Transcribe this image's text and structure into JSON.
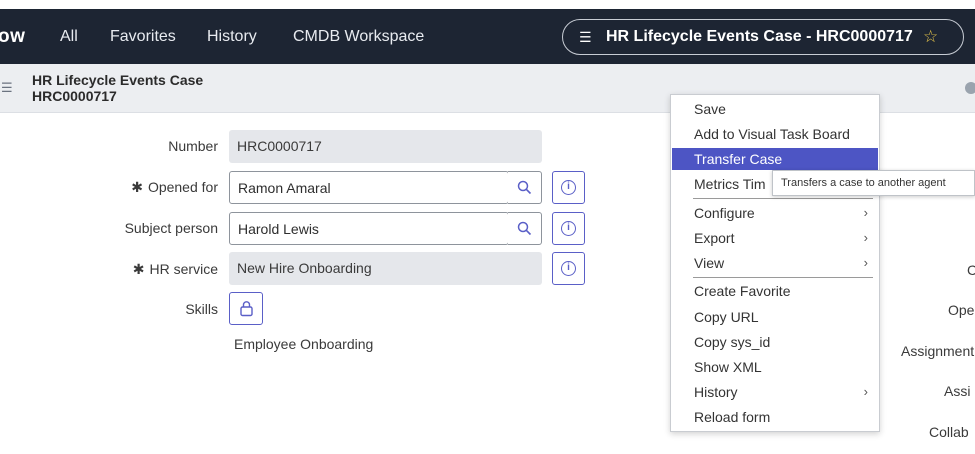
{
  "nav": {
    "logo": "ow",
    "items": [
      "All",
      "Favorites",
      "History",
      "CMDB Workspace"
    ],
    "record_title": "HR Lifecycle Events Case - HRC0000717"
  },
  "header": {
    "title_line1": "HR Lifecycle Events Case",
    "title_line2": "HRC0000717"
  },
  "form": {
    "number_label": "Number",
    "number_value": "HRC0000717",
    "opened_for_label": "Opened for",
    "opened_for_value": "Ramon Amaral",
    "subject_person_label": "Subject person",
    "subject_person_value": "Harold Lewis",
    "hr_service_label": "HR service",
    "hr_service_value": "New Hire Onboarding",
    "skills_label": "Skills",
    "skills_value": "Employee Onboarding",
    "required_mark": "✱"
  },
  "right_labels": [
    "C",
    "Ope",
    "Assignment",
    "Assi",
    "Collab"
  ],
  "context_menu": {
    "items": [
      {
        "label": "Save"
      },
      {
        "label": "Add to Visual Task Board"
      },
      {
        "label": "Transfer Case"
      },
      {
        "label": "Metrics Tim"
      },
      {
        "label": "Configure"
      },
      {
        "label": "Export"
      },
      {
        "label": "View"
      },
      {
        "label": "Create Favorite"
      },
      {
        "label": "Copy URL"
      },
      {
        "label": "Copy sys_id"
      },
      {
        "label": "Show XML"
      },
      {
        "label": "History"
      },
      {
        "label": "Reload form"
      }
    ],
    "chevron": "›"
  },
  "tooltip": "Transfers a case to another agent",
  "icons": {
    "menu": "☰",
    "star": "☆",
    "info": "i"
  },
  "colors": {
    "nav_bg": "#1d2533",
    "accent": "#4d55c4",
    "header_bg": "#eceef1"
  }
}
